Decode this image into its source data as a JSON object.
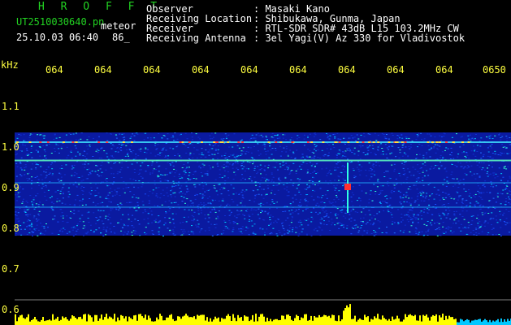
{
  "header": {
    "app_name": "H R O F F T",
    "filename": "UT2510030640.pn",
    "file_tag": "meteor",
    "datetime": "25.10.03 06:40",
    "count": "86_"
  },
  "info": {
    "labels": [
      "Observer",
      "Receiving Location",
      "Receiver",
      "Receiving Antenna"
    ],
    "values": [
      ": Masaki Kano",
      ": Shibukawa, Gunma, Japan",
      ": RTL-SDR SDR# 43dB L15 103.2MHz CW",
      ": 3el Yagi(V) Az 330 for Vladivostok"
    ]
  },
  "axis": {
    "unit": "kHz",
    "y_labels": [
      "1.1",
      "1.0",
      "0.9",
      "0.8",
      "0.7",
      "0.6"
    ],
    "y_values": [
      1.1,
      1.0,
      0.9,
      0.8,
      0.7,
      0.6
    ],
    "x_labels": [
      "064",
      "064",
      "064",
      "064",
      "064",
      "064",
      "064",
      "064",
      "064",
      "0650"
    ]
  },
  "colors": {
    "text_primary": "#22d322",
    "axis_labels": "#ffff40",
    "spectrum_background": "#0a1aa0",
    "power_bars": "#ffff00",
    "power_bars_low": "#00c8ff"
  }
}
